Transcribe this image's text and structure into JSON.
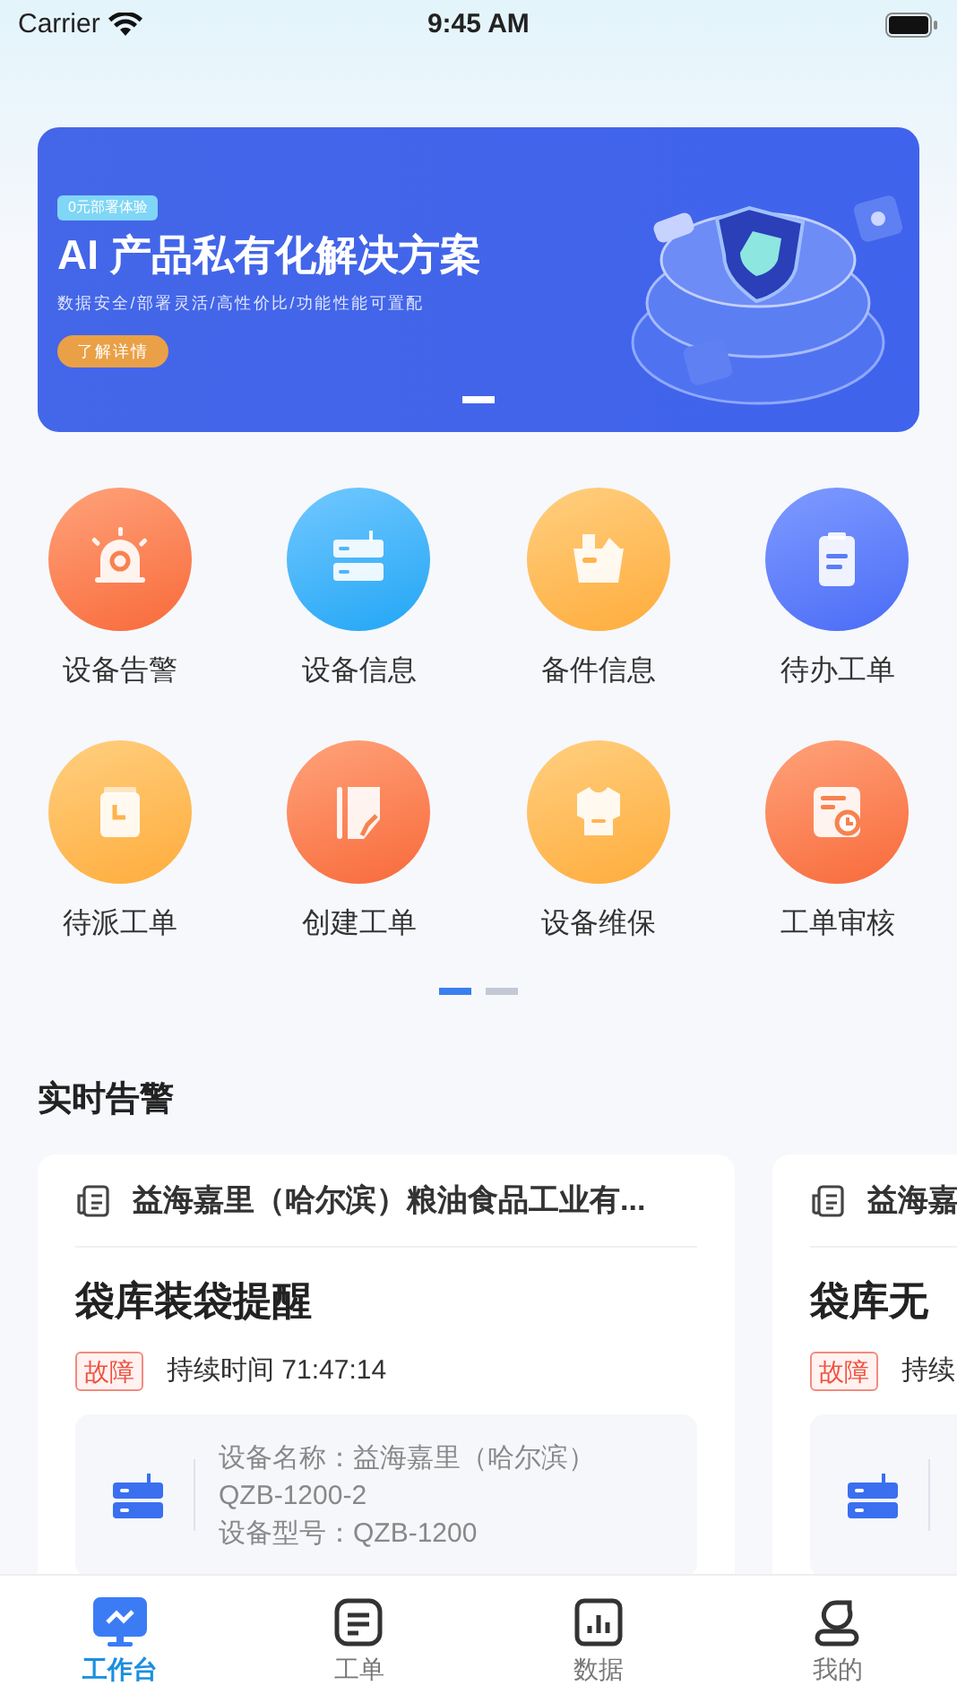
{
  "status_bar": {
    "carrier": "Carrier",
    "time": "9:45 AM"
  },
  "banner": {
    "tag": "0元部署体验",
    "title": "AI 产品私有化解决方案",
    "subtitle": "数据安全/部署灵活/高性价比/功能性能可置配",
    "button": "了解详情",
    "pages": [
      {
        "selected": true
      }
    ]
  },
  "shortcuts": [
    {
      "label": "设备告警"
    },
    {
      "label": "设备信息"
    },
    {
      "label": "备件信息"
    },
    {
      "label": "待办工单"
    },
    {
      "label": "待派工单"
    },
    {
      "label": "创建工单"
    },
    {
      "label": "设备维保"
    },
    {
      "label": "工单审核"
    }
  ],
  "shortcut_pages": [
    {
      "selected": true
    },
    {
      "selected": false
    }
  ],
  "alerts_section": {
    "title": "实时告警",
    "cards": [
      {
        "company": "益海嘉里（哈尔滨）粮油食品工业有...",
        "title": "袋库装袋提醒",
        "tag": "故障",
        "duration": "持续时间 71:47:14",
        "device_name": "设备名称：益海嘉里（哈尔滨）QZB-1200-2",
        "device_model": "设备型号：QZB-1200"
      },
      {
        "company": "益海嘉",
        "title": "袋库无",
        "tag": "故障",
        "duration": "持续"
      }
    ]
  },
  "tab_bar": [
    {
      "label": "工作台",
      "selected": true
    },
    {
      "label": "工单",
      "selected": false
    },
    {
      "label": "数据",
      "selected": false
    },
    {
      "label": "我的",
      "selected": false
    }
  ]
}
